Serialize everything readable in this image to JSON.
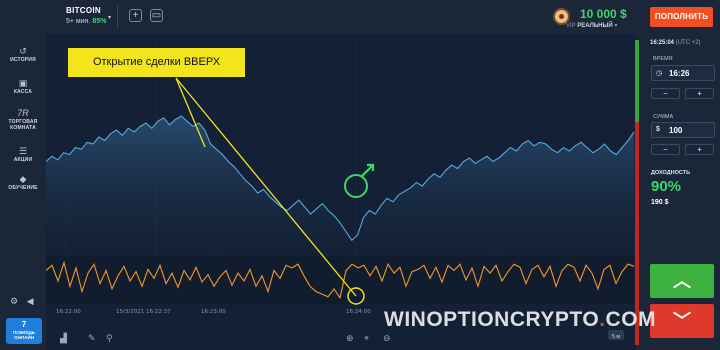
{
  "header": {
    "asset_name": "BITCOIN",
    "asset_expiry": "5+ мин.",
    "asset_payout": "85%",
    "balance": "10 000 $",
    "vip_label": "VIP",
    "account_type": "РЕАЛЬНЫЙ",
    "deposit_label": "ПОПОЛНИТЬ"
  },
  "sidebar": {
    "items": [
      {
        "label": "ИСТОРИЯ",
        "icon": "history-icon"
      },
      {
        "label": "КАССА",
        "icon": "wallet-icon"
      },
      {
        "label": "ТОРГОВАЯ КОМНАТА",
        "icon": "trading-room-icon",
        "badge": "7R"
      },
      {
        "label": "АКЦИИ",
        "icon": "promotions-icon"
      },
      {
        "label": "ОБУЧЕНИЕ",
        "icon": "education-icon"
      }
    ],
    "help_count": "7",
    "help_label": "ПОМОЩЬ ОНЛАЙН"
  },
  "chart": {
    "callout": "Открытие сделки ВВЕРХ",
    "time_labels": [
      "16:22:00",
      "15/3/2021 16:22:37",
      "16:23:00",
      "16:24:00"
    ],
    "zoom_label": "5 м",
    "accent_line": "#5aa8dc",
    "oscillator_line": "#f2972b",
    "marker_color": "#3dd66b",
    "callout_color": "#f2e51c"
  },
  "chart_data": {
    "type": "line",
    "title": "",
    "xlabel": "",
    "ylabel": "",
    "series": [
      {
        "values": [
          50,
          53,
          51,
          55,
          54,
          58,
          57,
          61,
          60,
          64,
          62,
          66,
          68,
          65,
          69,
          67,
          70,
          72,
          69,
          73,
          75,
          71,
          74,
          76,
          73,
          70,
          72,
          68,
          60,
          57,
          54,
          50,
          47,
          43,
          39,
          36,
          32,
          34,
          30,
          27,
          24,
          22,
          25,
          28,
          24,
          20,
          23,
          26,
          22,
          19,
          15,
          10,
          5,
          8,
          18,
          22,
          20,
          25,
          29,
          27,
          31,
          33,
          35,
          38,
          36,
          40,
          43,
          41,
          45,
          48,
          46,
          50,
          52,
          49,
          51,
          53,
          50,
          52,
          55,
          58,
          56,
          60,
          62,
          59,
          61,
          60,
          57,
          55,
          58,
          56,
          59,
          61,
          58,
          55,
          57,
          60,
          56,
          54,
          58,
          62,
          67
        ]
      },
      {
        "values": [
          60,
          70,
          40,
          75,
          30,
          65,
          20,
          55,
          72,
          35,
          60,
          25,
          50,
          68,
          40,
          58,
          30,
          62,
          45,
          70,
          35,
          55,
          28,
          60,
          42,
          66,
          38,
          52,
          30,
          48,
          60,
          32,
          55,
          40,
          62,
          30,
          50,
          20,
          60,
          45,
          70,
          65,
          72,
          50,
          30,
          20,
          15,
          10,
          25,
          8,
          60,
          72,
          65,
          70,
          50,
          68,
          40,
          72,
          55,
          66,
          30,
          58,
          62,
          70,
          45,
          66,
          38,
          70,
          60,
          72,
          42,
          65,
          30,
          68,
          55,
          70,
          40,
          58,
          72,
          66,
          35,
          62,
          70,
          48,
          68,
          30,
          60,
          72,
          66,
          40,
          70,
          55,
          25,
          62,
          70,
          35,
          58,
          72,
          68
        ]
      }
    ]
  },
  "trade": {
    "clock": "16:25:04",
    "timezone": "(UTC +2)",
    "time_label": "ВРЕМЯ",
    "time_value": "16:26",
    "amount_label": "СУММА",
    "amount_value": "100",
    "amount_currency": "$",
    "minus": "−",
    "plus": "+",
    "profit_label": "ДОХОДНОСТЬ",
    "profit_pct": "90%",
    "profit_amount": "190 $",
    "up_glyph": "︿",
    "down_glyph": "﹀",
    "up_color": "#3eb23f",
    "down_color": "#e0392b"
  },
  "watermark": {
    "text": "WINOPTIONCRYPTO",
    "dot": ".",
    "suffix": "COM"
  }
}
